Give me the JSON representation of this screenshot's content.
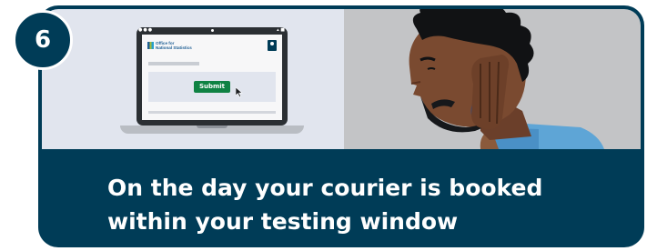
{
  "step": {
    "number": "6"
  },
  "caption": {
    "line1": "On the day your courier is booked",
    "line2": "within your testing window"
  },
  "laptop": {
    "browser_dots": "●●●",
    "browser_icons": "▴ ■",
    "logo_line1": "Office for",
    "logo_line2": "National Statistics",
    "submit_label": "Submit"
  },
  "icons": {
    "cursor": "cursor-arrow-icon",
    "crest": "crest-icon",
    "logo": "ons-logo-icon"
  },
  "colors": {
    "card": "#003c57",
    "left_panel": "#e1e5ee",
    "right_panel": "#c3c4c6",
    "submit": "#0f8243",
    "text": "#ffffff"
  }
}
